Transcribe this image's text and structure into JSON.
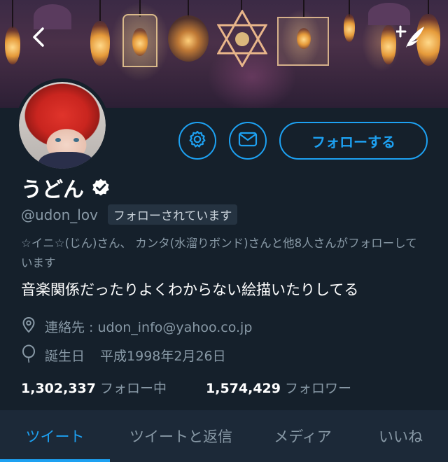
{
  "header": {
    "back_icon": "chevron-left-icon",
    "compose_icon": "compose-tweet-icon"
  },
  "profile": {
    "display_name": "うどん",
    "verified": true,
    "handle": "@udon_lov",
    "follows_you": "フォローされています",
    "followed_by": "☆イニ☆(じん)さん、 カンタ(水溜りボンド)さんと他8人さんがフォローしています",
    "bio": "音楽関係だったりよくわからない絵描いたりしてる",
    "contact_label": "連絡先 : udon_info@yahoo.co.jp",
    "birthday_label": "誕生日",
    "birthday_value": "平成1998年2月26日",
    "following_count": "1,302,337",
    "following_label": "フォロー中",
    "followers_count": "1,574,429",
    "followers_label": "フォロワー"
  },
  "actions": {
    "settings_icon": "gear-icon",
    "message_icon": "envelope-icon",
    "follow_label": "フォローする"
  },
  "tabs": [
    {
      "label": "ツイート",
      "active": true
    },
    {
      "label": "ツイートと返信",
      "active": false
    },
    {
      "label": "メディア",
      "active": false
    },
    {
      "label": "いいね",
      "active": false
    }
  ],
  "colors": {
    "background": "#15202b",
    "accent": "#1da1f2",
    "secondary_text": "#8899a6",
    "tab_bar": "#1c2938"
  }
}
